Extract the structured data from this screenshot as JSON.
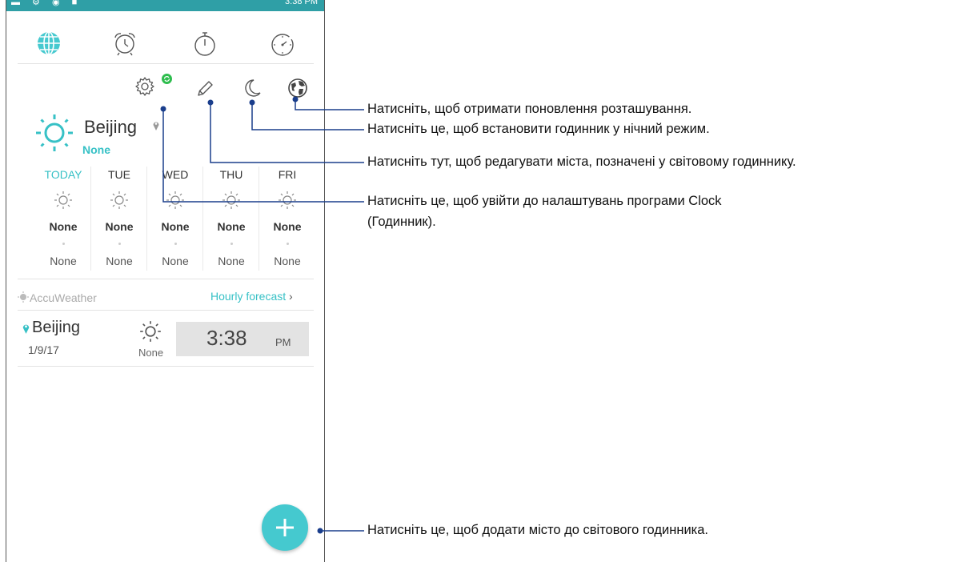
{
  "status_bar": {
    "time": "3:38 PM"
  },
  "tabs": [
    {
      "name": "World Clock",
      "icon": "globe-icon",
      "active": true
    },
    {
      "name": "Alarm",
      "icon": "alarm-clock-icon"
    },
    {
      "name": "Stopwatch",
      "icon": "stopwatch-icon"
    },
    {
      "name": "Timer",
      "icon": "timer-icon"
    }
  ],
  "toolbar": {
    "settings_icon": "gear-icon",
    "edit_icon": "pencil-icon",
    "night_icon": "moon-icon",
    "location_icon": "earth-icon"
  },
  "city": {
    "name": "Beijing",
    "condition": "None"
  },
  "forecast": [
    {
      "day": "TODAY",
      "high": "None",
      "low": "None"
    },
    {
      "day": "TUE",
      "high": "None",
      "low": "None"
    },
    {
      "day": "WED",
      "high": "None",
      "low": "None"
    },
    {
      "day": "THU",
      "high": "None",
      "low": "None"
    },
    {
      "day": "FRI",
      "high": "None",
      "low": "None"
    }
  ],
  "provider": "AccuWeather",
  "hourly_link": "Hourly forecast",
  "world_clock": {
    "city": "Beijing",
    "date": "1/9/17",
    "condition": "None",
    "time": "3:38",
    "ampm": "PM"
  },
  "callouts": {
    "location": "Натисніть, щоб отримати поновлення розташування.",
    "night": "Натисніть це, щоб встановити годинник у нічний режим.",
    "edit": "Натисніть тут, щоб редагувати міста, позначені у світовому годиннику.",
    "settings_line1": "Натисніть це, щоб увійти до налаштувань програми Clock",
    "settings_line2": "(Годинник).",
    "add": "Натисніть це, щоб додати місто до світового годинника."
  },
  "colors": {
    "accent": "#37c1c6",
    "fab": "#45c9cf",
    "status": "#2f9fa6"
  }
}
